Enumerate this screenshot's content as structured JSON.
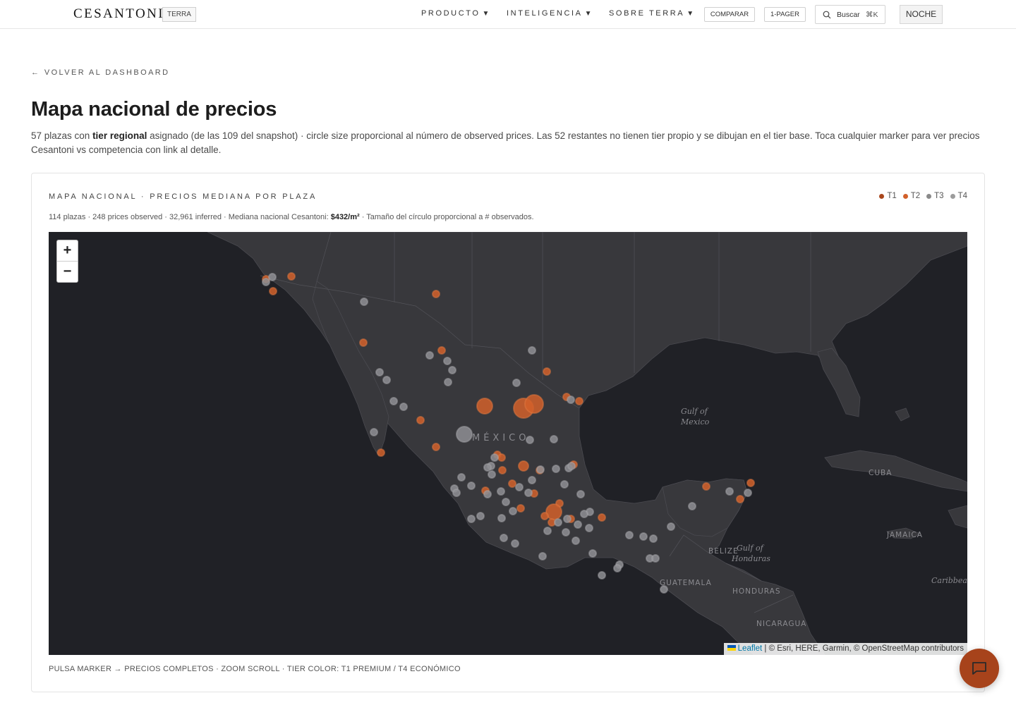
{
  "header": {
    "logo": "CESANTONI",
    "logo_tag": "TERRA",
    "nav": [
      {
        "label": "PRODUCTO",
        "caret": "▼"
      },
      {
        "label": "INTELIGENCIA",
        "caret": "▼"
      },
      {
        "label": "SOBRE TERRA",
        "caret": "▼"
      }
    ],
    "compare_label": "COMPARAR",
    "onepager_label": "1-PAGER",
    "search_label": "Buscar",
    "search_shortcut": "⌘K",
    "theme_label": "NOCHE"
  },
  "page": {
    "back_link": "← VOLVER AL DASHBOARD",
    "title": "Mapa nacional de precios",
    "desc_pre": "57 plazas con ",
    "desc_bold": "tier regional",
    "desc_post": " asignado (de las 109 del snapshot) · circle size proporcional al número de observed prices. Las 52 restantes no tienen tier propio y se dibujan en el tier base. Toca cualquier marker para ver precios Cesantoni vs competencia con link al detalle."
  },
  "card": {
    "title": "MAPA NACIONAL · PRECIOS MEDIANA POR PLAZA",
    "legend": [
      {
        "label": "T1",
        "color": "#a9471c"
      },
      {
        "label": "T2",
        "color": "#d2602a"
      },
      {
        "label": "T3",
        "color": "#8a8a8a"
      },
      {
        "label": "T4",
        "color": "#9c9c9c"
      }
    ],
    "sub_pre": "114 plazas · 248 prices observed · 32,961 inferred · Mediana nacional Cesantoni: ",
    "sub_value": "$432/m²",
    "sub_post": " · Tamaño del círculo proporcional a # observados.",
    "footer": "PULSA MARKER → PRECIOS COMPLETOS · ZOOM SCROLL · TIER COLOR: T1 PREMIUM / T4 ECONÓMICO"
  },
  "map": {
    "zoom_in": "+",
    "zoom_out": "−",
    "attribution_link": "Leaflet",
    "attribution_text": " | © Esri, HERE, Garmin, © OpenStreetMap contributors",
    "labels": {
      "mexico": "MÉXICO",
      "gulf1": "Gulf of",
      "gulf2": "Mexico",
      "cuba": "CUBA",
      "jamaica": "JAMAICA",
      "belize": "BELIZE",
      "gulf_hon1": "Gulf of",
      "gulf_hon2": "Honduras",
      "guatemala": "GUATEMALA",
      "honduras": "HONDURAS",
      "nicaragua": "NICARAGUA",
      "caribbean": "Caribbean"
    },
    "colors": {
      "orange": "#d2602a",
      "gray": "#8e8e93",
      "land": "#38383c",
      "water": "#202126"
    }
  }
}
